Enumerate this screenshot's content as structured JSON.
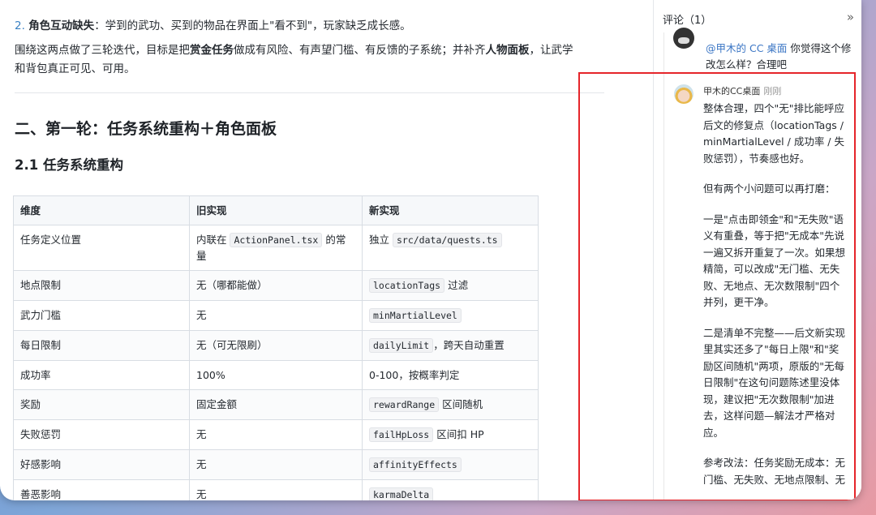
{
  "doc": {
    "item2_num": "2.",
    "item2_bold": "角色互动缺失",
    "item2_rest": "：学到的武功、买到的物品在界面上\"看不到\"，玩家缺乏成长感。",
    "para_a": "围绕这两点做了三轮迭代，目标是把",
    "para_b": "赏金任务",
    "para_c": "做成有风险、有声望门槛、有反馈的子系统；并补齐",
    "para_d": "人物面板",
    "para_e": "，让武学",
    "para_line2": "和背包真正可见、可用。",
    "h2": "二、第一轮：任务系统重构＋角色面板",
    "h3": "2.1 任务系统重构"
  },
  "table": {
    "headers": [
      "维度",
      "旧实现",
      "新实现"
    ],
    "rows": [
      {
        "dim": "任务定义位置",
        "old_pre": "内联在 ",
        "old_code": "ActionPanel.tsx",
        "old_post": " 的常量",
        "new_pre": "独立 ",
        "new_code": "src/data/quests.ts",
        "new_post": ""
      },
      {
        "dim": "地点限制",
        "old": "无（哪都能做）",
        "new_code": "locationTags",
        "new_post": " 过滤"
      },
      {
        "dim": "武力门槛",
        "old": "无",
        "new_code": "minMartialLevel",
        "new_post": ""
      },
      {
        "dim": "每日限制",
        "old": "无（可无限刷）",
        "new_code": "dailyLimit",
        "new_post": "，跨天自动重置"
      },
      {
        "dim": "成功率",
        "old": "100%",
        "new_text": "0-100，按概率判定"
      },
      {
        "dim": "奖励",
        "old": "固定金额",
        "new_code": "rewardRange",
        "new_post": " 区间随机"
      },
      {
        "dim": "失败惩罚",
        "old": "无",
        "new_code": "failHpLoss",
        "new_post": " 区间扣 HP"
      },
      {
        "dim": "好感影响",
        "old": "无",
        "new_code": "affinityEffects",
        "new_post": ""
      },
      {
        "dim": "善恶影响",
        "old": "无",
        "new_code": "karmaDelta",
        "new_post": ""
      }
    ]
  },
  "comments": {
    "panel_title": "评论（1）",
    "collapse_icon": "»",
    "first": {
      "mention": "@甲木的 CC 桌面",
      "text": " 你觉得这个修改怎么样？合理吧"
    },
    "reply": {
      "author": "甲木的CC桌面",
      "time": "刚刚",
      "paragraphs": [
        "整体合理，四个\"无\"排比能呼应后文的修复点（locationTags / minMartialLevel / 成功率 / 失败惩罚），节奏感也好。",
        "但有两个小问题可以再打磨：",
        "一是\"点击即领金\"和\"无失败\"语义有重叠，等于把\"无成本\"先说一遍又拆开重复了一次。如果想精简，可以改成\"无门槛、无失败、无地点、无次数限制\"四个并列，更干净。",
        "二是清单不完整——后文新实现里其实还多了\"每日上限\"和\"奖励区间随机\"两项，原版的\"无每日限制\"在这句问题陈述里没体现，建议把\"无次数限制\"加进去，这样问题—解法才严格对应。",
        "参考改法：任务奖励无成本：无门槛、无失败、无地点限制、无"
      ]
    }
  },
  "colors": {
    "highlight": "#e5252a",
    "link": "#3a75c4"
  }
}
